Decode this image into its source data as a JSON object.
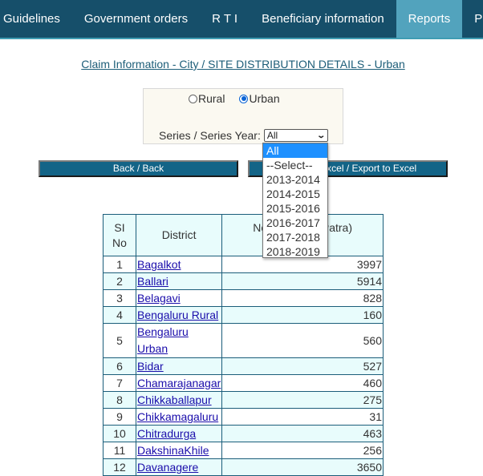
{
  "nav": {
    "items": [
      {
        "label": "Guidelines",
        "active": false
      },
      {
        "label": "Government orders",
        "active": false
      },
      {
        "label": "R T I",
        "active": false
      },
      {
        "label": "Beneficiary information",
        "active": false
      },
      {
        "label": "Reports",
        "active": true
      },
      {
        "label": "Photo",
        "active": false
      }
    ]
  },
  "page_title": "Claim Information - City / SITE DISTRIBUTION DETAILS - Urban",
  "filter": {
    "radio_rural": "Rural",
    "radio_urban": "Urban",
    "selected_radio": "Urban",
    "series_label": "Series / Series Year:",
    "series_value": "All",
    "options": [
      "All",
      "--Select--",
      "2013-2014",
      "2014-2015",
      "2015-2016",
      "2016-2017",
      "2017-2018",
      "2018-2019"
    ],
    "highlighted_option": "All"
  },
  "buttons": {
    "back": "Back / Back",
    "export": "Export to Excel / Export to Excel"
  },
  "table": {
    "headers": {
      "sl_no": "SI No",
      "district": "District",
      "value": "No. of (HakkuPatra) ...",
      "value_visible_fragments": [
        "No. o",
        "kuPatra)"
      ]
    },
    "rows": [
      {
        "sl": "1",
        "district": "Bagalkot",
        "value": "3997"
      },
      {
        "sl": "2",
        "district": "Ballari",
        "value": "5914"
      },
      {
        "sl": "3",
        "district": "Belagavi",
        "value": "828"
      },
      {
        "sl": "4",
        "district": "Bengaluru Rural",
        "value": "160"
      },
      {
        "sl": "5",
        "district": "Bengaluru Urban",
        "value": "560"
      },
      {
        "sl": "6",
        "district": "Bidar",
        "value": "527"
      },
      {
        "sl": "7",
        "district": "Chamarajanagar",
        "value": "460"
      },
      {
        "sl": "8",
        "district": "Chikkaballapur",
        "value": "275"
      },
      {
        "sl": "9",
        "district": "Chikkamagaluru",
        "value": "31"
      },
      {
        "sl": "10",
        "district": "Chitradurga",
        "value": "463"
      },
      {
        "sl": "11",
        "district": "DakshinaKhile",
        "value": "256"
      },
      {
        "sl": "12",
        "district": "Davanagere",
        "value": "3650"
      }
    ]
  },
  "colors": {
    "nav_bg": "#164f6a",
    "nav_active": "#52a3bd",
    "button_bg": "#136487",
    "table_border": "#1b5d7a",
    "row_alt": "#e8fcfc",
    "link": "#1a0dab",
    "dropdown_highlight": "#1e90ff"
  }
}
